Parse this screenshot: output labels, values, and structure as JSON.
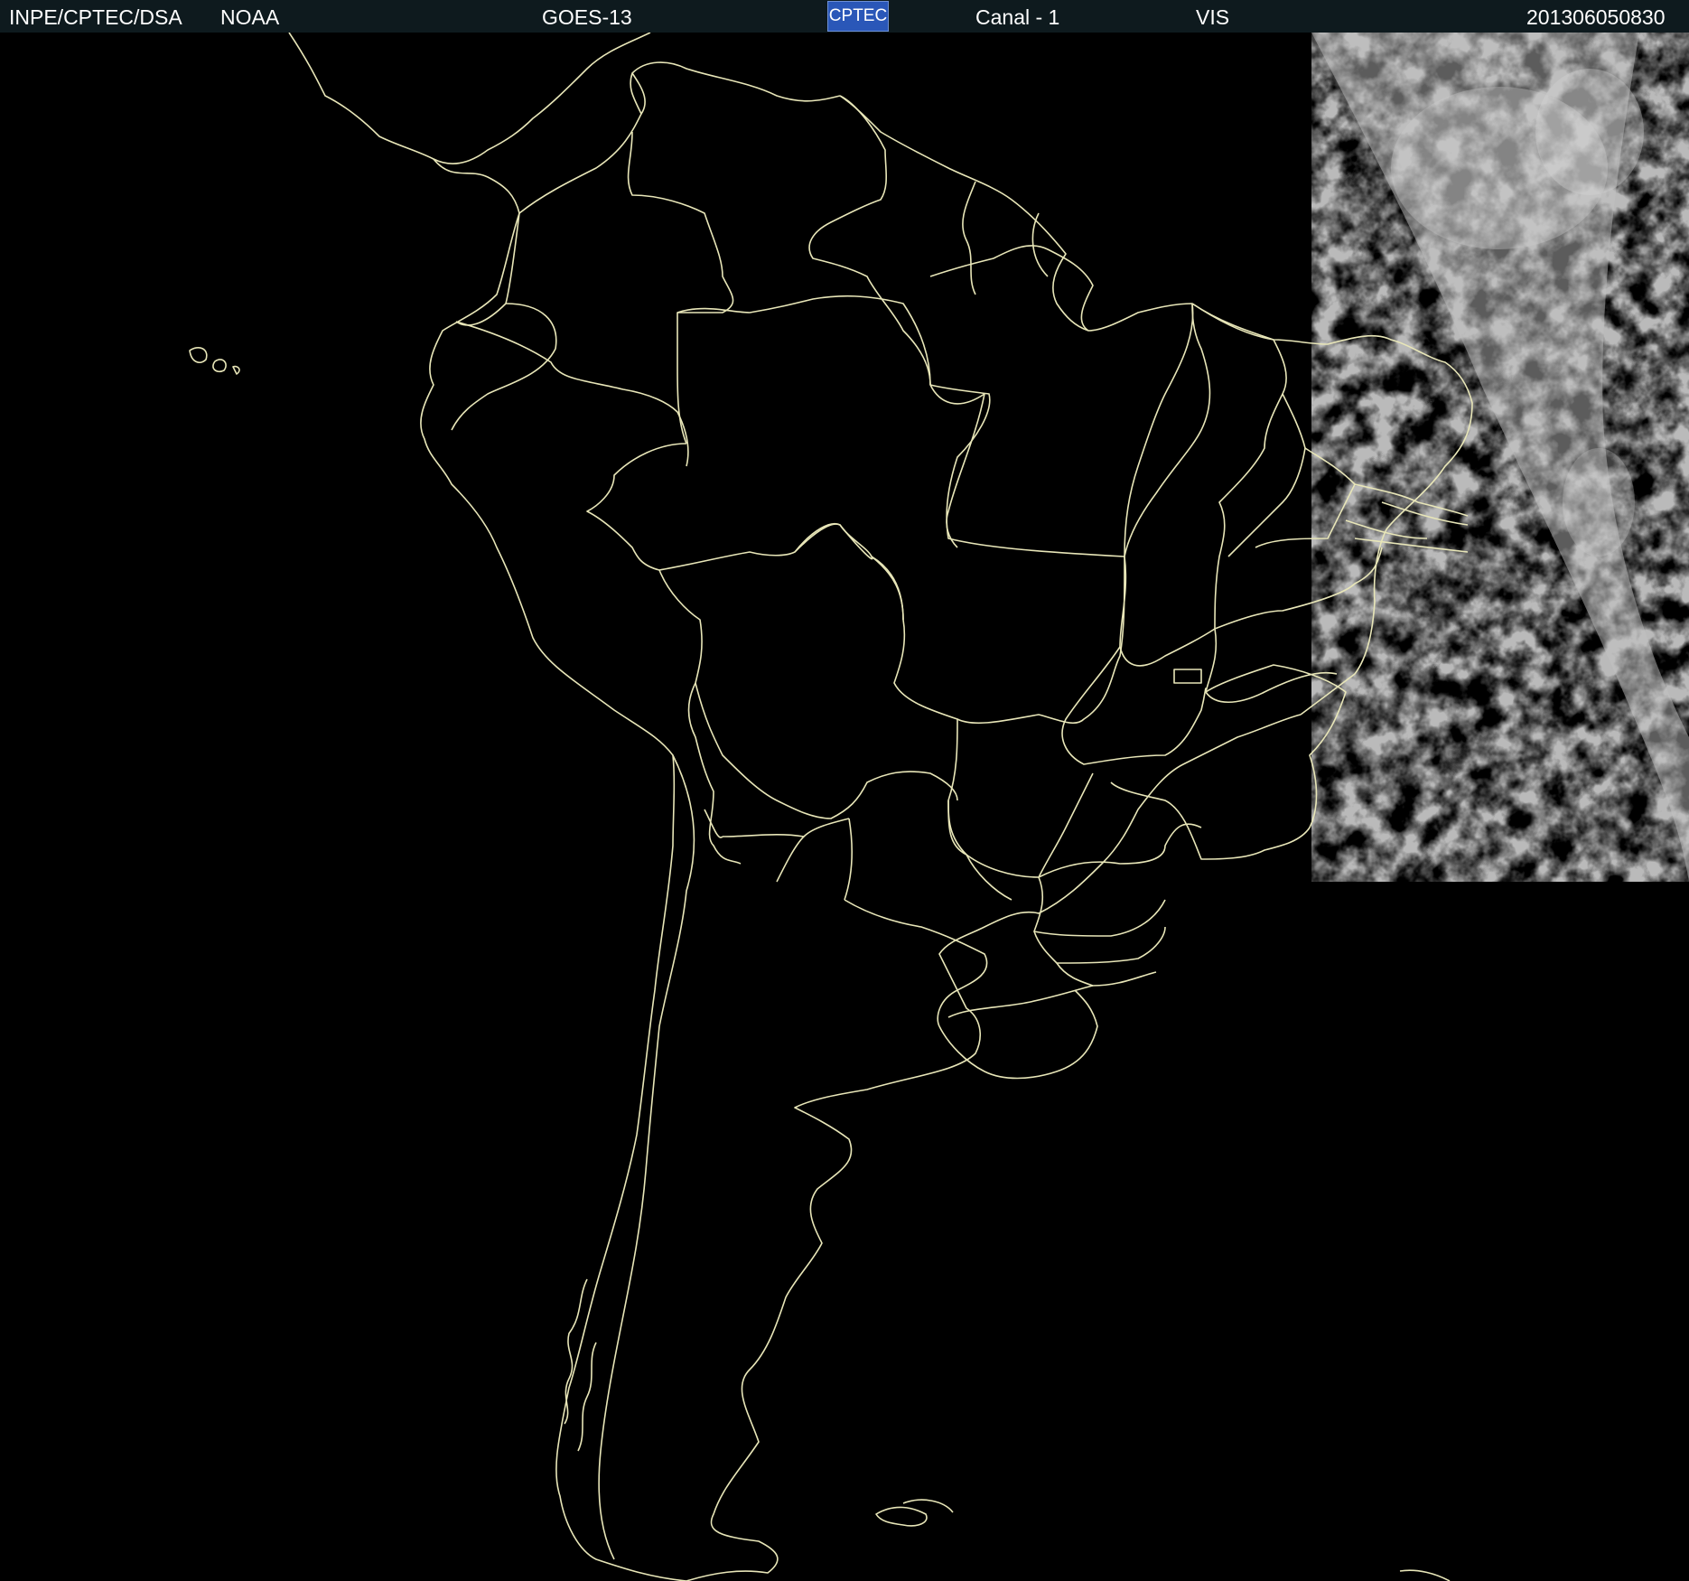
{
  "header": {
    "agency": "INPE/CPTEC/DSA",
    "source": "NOAA",
    "satellite": "GOES-13",
    "logo_text": "CPTEC",
    "channel": "Canal - 1",
    "band": "VIS",
    "timestamp": "201306050830"
  },
  "colors": {
    "header_bg": "#0e1a1e",
    "background": "#000000",
    "borders": "#e8e6b8",
    "clouds": "#bdbdbd",
    "logo_bg": "#2a57b8"
  },
  "map": {
    "region": "South America",
    "imagery": "visible-channel satellite image with daylight terminator on the east edge",
    "overlay": "political country and state boundaries"
  }
}
